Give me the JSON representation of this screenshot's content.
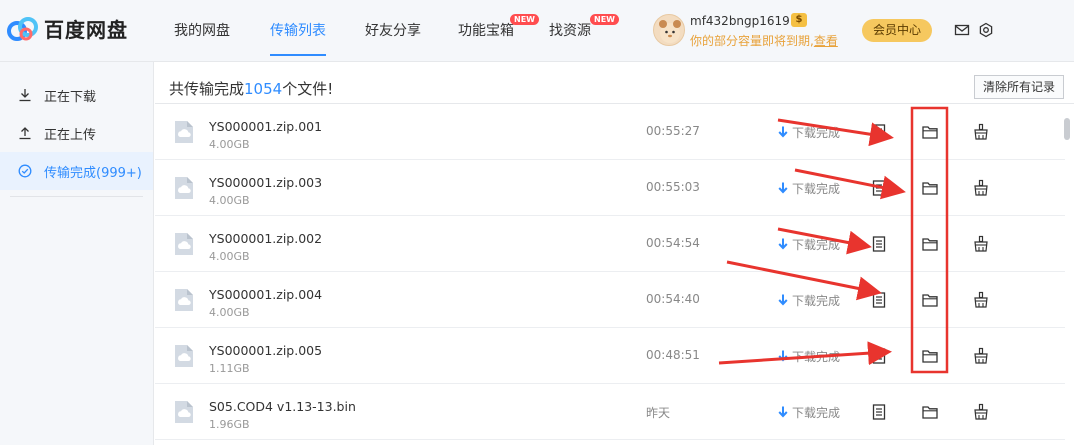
{
  "app": {
    "name": "百度网盘"
  },
  "nav": [
    {
      "label": "我的网盘"
    },
    {
      "label": "传输列表"
    },
    {
      "label": "好友分享"
    },
    {
      "label": "功能宝箱",
      "badge": "NEW"
    },
    {
      "label": "找资源",
      "badge": "NEW"
    }
  ],
  "user": {
    "name": "mf432bngp1619",
    "coin": "$",
    "message": "你的部分容量即将到期,",
    "message_link": "查看",
    "vip_label": "会员中心"
  },
  "sidebar": {
    "items": [
      {
        "label": "正在下载",
        "icon": "download-icon"
      },
      {
        "label": "正在上传",
        "icon": "upload-icon"
      },
      {
        "label": "传输完成(999+)",
        "icon": "check-circle-icon"
      }
    ]
  },
  "summary": {
    "prefix": "共传输完成",
    "count": "1054",
    "suffix": "个文件!"
  },
  "clear_label": "清除所有记录",
  "files": [
    {
      "name": "YS000001.zip.001",
      "size": "4.00GB",
      "time": "00:55:27",
      "status": "下载完成"
    },
    {
      "name": "YS000001.zip.003",
      "size": "4.00GB",
      "time": "00:55:03",
      "status": "下载完成"
    },
    {
      "name": "YS000001.zip.002",
      "size": "4.00GB",
      "time": "00:54:54",
      "status": "下载完成"
    },
    {
      "name": "YS000001.zip.004",
      "size": "4.00GB",
      "time": "00:54:40",
      "status": "下载完成"
    },
    {
      "name": "YS000001.zip.005",
      "size": "1.11GB",
      "time": "00:48:51",
      "status": "下载完成"
    },
    {
      "name": "S05.COD4 v1.13-13.bin",
      "size": "1.96GB",
      "time": "昨天",
      "status": "下载完成"
    }
  ],
  "colors": {
    "accent": "#2f8cff",
    "annotation": "#e8342e",
    "vip": "#f6c85f"
  }
}
